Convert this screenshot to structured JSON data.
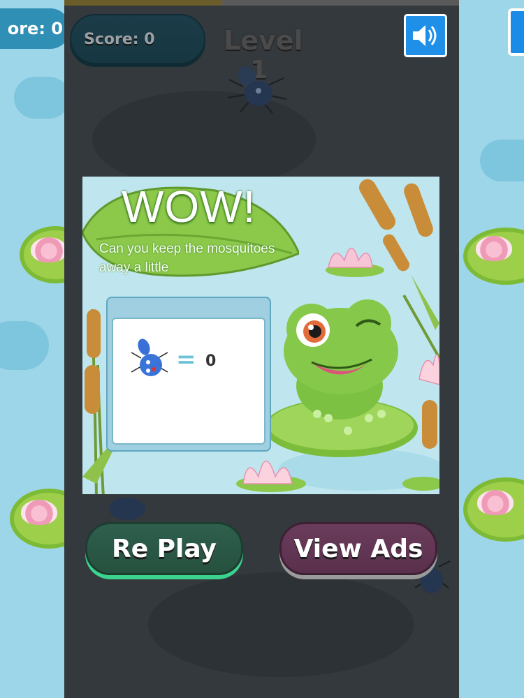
{
  "hud": {
    "score_label": "Score: 0",
    "side_score_fragment": "ore: 0",
    "level_label": "Level",
    "level_number": "1",
    "progress_fraction": 0.4,
    "sound_icon": "speaker-icon"
  },
  "dialog": {
    "title": "WOW!",
    "message": "Can you keep the mosquitoes away a little",
    "equals_sign": "=",
    "kill_count": "0",
    "bug_icon": "mosquito-icon"
  },
  "buttons": {
    "replay_label": "Re Play",
    "view_ads_label": "View Ads"
  },
  "colors": {
    "panel_bg": "#bfe6ef",
    "replay_glow": "#3bd38e",
    "ads_button": "#6a3c5b",
    "sound_button": "#1f8fe8"
  }
}
